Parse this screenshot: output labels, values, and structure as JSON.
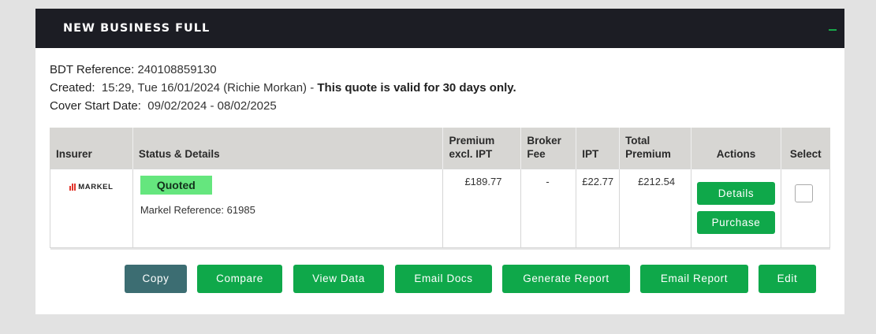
{
  "panel": {
    "title": "NEW BUSINESS FULL",
    "accent_color": "#18a84a",
    "header_color": "#1c1d24"
  },
  "info": {
    "bdt_label": "BDT Reference:",
    "bdt_value": "240108859130",
    "created_label": "Created:",
    "created_value": "15:29, Tue 16/01/2024 (Richie Morkan) -",
    "validity_note": "This quote is valid for 30 days only.",
    "cover_label": "Cover Start Date:",
    "cover_value": "09/02/2024 - 08/02/2025"
  },
  "table": {
    "headers": {
      "insurer": "Insurer",
      "status": "Status & Details",
      "premium_l1": "Premium",
      "premium_l2": "excl. IPT",
      "broker_l1": "Broker",
      "broker_l2": "Fee",
      "ipt": "IPT",
      "total_l1": "Total",
      "total_l2": "Premium",
      "actions": "Actions",
      "select": "Select"
    },
    "row": {
      "insurer_logo_text": "MARKEL",
      "status": "Quoted",
      "reference_label": "Markel Reference:",
      "reference_value": "61985",
      "premium": "£189.77",
      "broker_fee": "-",
      "ipt": "£22.77",
      "total": "£212.54",
      "details_label": "Details",
      "purchase_label": "Purchase"
    }
  },
  "buttons": {
    "copy": "Copy",
    "compare": "Compare",
    "view_data": "View Data",
    "email_docs": "Email Docs",
    "generate_report": "Generate Report",
    "email_report": "Email Report",
    "edit": "Edit"
  },
  "colors": {
    "primary_button": "#0fa84a",
    "copy_button": "#3c6d72",
    "status_badge": "#65e67e"
  }
}
